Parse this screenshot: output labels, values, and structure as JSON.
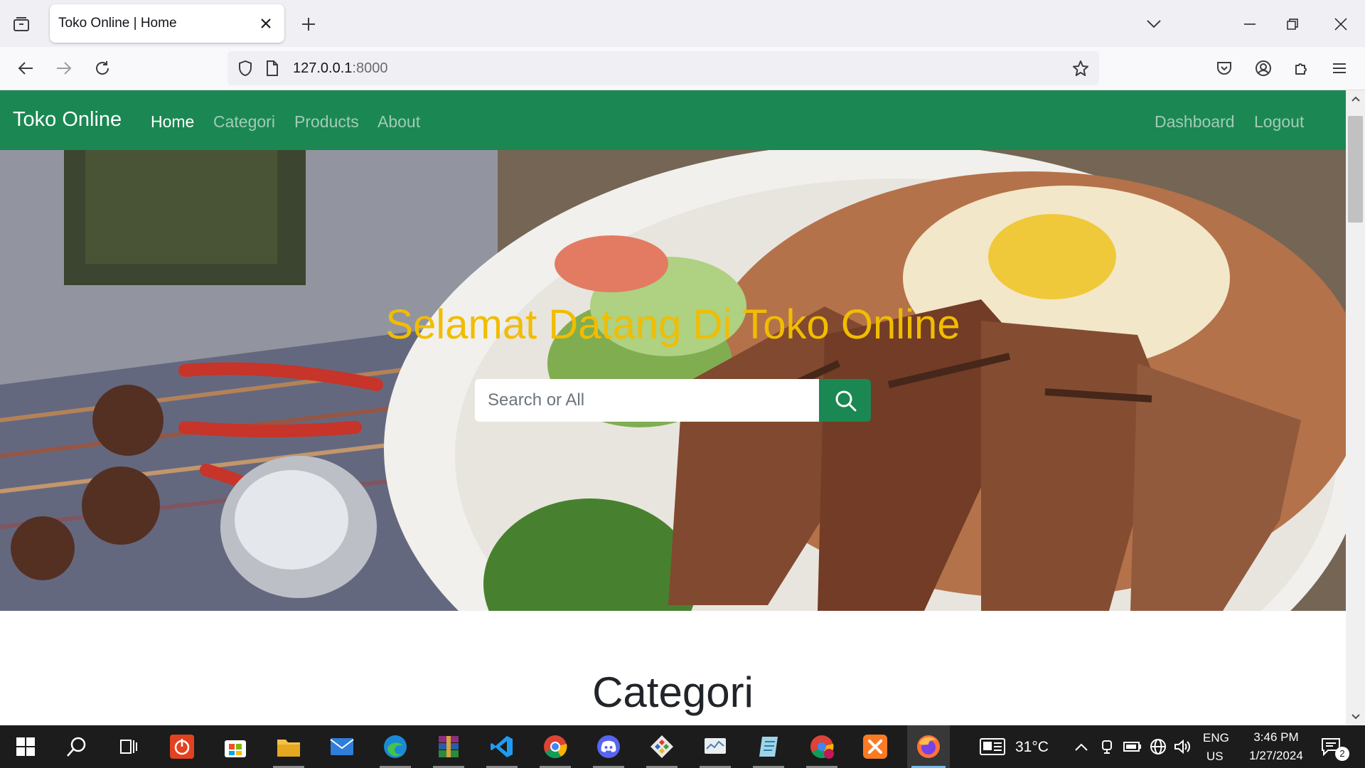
{
  "browser": {
    "tab_title": "Toko Online | Home",
    "url_host": "127.0.0.1",
    "url_port": ":8000",
    "icons": {
      "tab_list": "tab-list-icon",
      "tab_close": "close-icon",
      "new_tab": "plus-icon",
      "list_all_tabs": "chevron-down-icon",
      "back": "arrow-left-icon",
      "forward": "arrow-right-icon",
      "reload": "reload-icon",
      "tracking_protection": "shield-icon",
      "page_info": "page-icon",
      "bookmark": "star-icon",
      "pocket": "pocket-icon",
      "account": "account-icon",
      "extensions": "puzzle-icon",
      "menu": "hamburger-icon"
    }
  },
  "site": {
    "brand": "Toko Online",
    "nav": {
      "home": "Home",
      "categori": "Categori",
      "products": "Products",
      "about": "About",
      "dashboard": "Dashboard",
      "logout": "Logout"
    },
    "hero": {
      "title": "Selamat Datang Di Toko Online",
      "search_placeholder": "Search or All"
    },
    "section_heading": "Categori",
    "colors": {
      "primary_green": "#1b8752",
      "hero_title": "#f1bd00"
    }
  },
  "taskbar": {
    "weather_temp": "31°C",
    "language_line1": "ENG",
    "language_line2": "US",
    "time": "3:46 PM",
    "date": "1/27/2024",
    "notification_count": "2"
  }
}
